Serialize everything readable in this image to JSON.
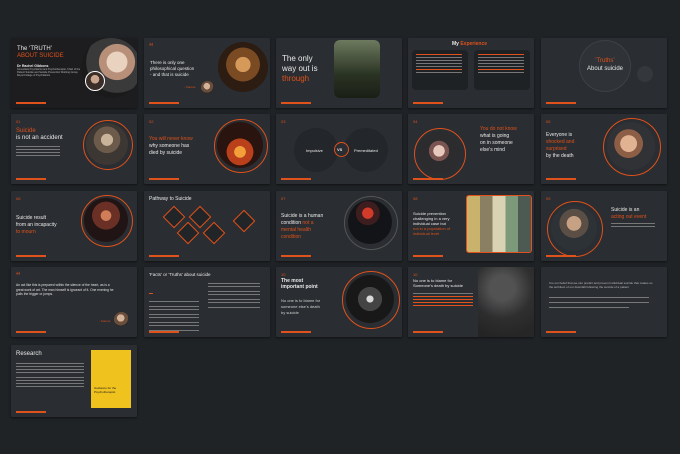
{
  "slides": [
    {
      "title_l1": "The ‘TRUTH’",
      "title_l2": "ABOUT SUICIDE",
      "author": "Dr Rachel Gibbons",
      "author_desc": "Consultant Psychiatrist and Psychotherapist, Chair of the Patient Suicide and Suicide Prevention Working Group, Royal College of Psychiatrists"
    },
    {
      "quote_l1": "There is only one",
      "quote_l2": "philosophical question",
      "quote_l3": "- and that is suicide",
      "attribution": "- Camus"
    },
    {
      "l1": "The only",
      "l2": "way out is",
      "l3": "through"
    },
    {
      "prefix": "My",
      "title": "Experience"
    },
    {
      "l1": "‘Truths’",
      "l2": "About suicide"
    },
    {
      "num": "01",
      "l1": "Suicide",
      "l2": "is not an accident"
    },
    {
      "num": "02",
      "l1": "You will never know",
      "l2": "why someone has",
      "l3": "died by suicide"
    },
    {
      "num": "03",
      "left": "Impulsive",
      "vs": "VS",
      "right": "Premeditated"
    },
    {
      "num": "04",
      "l1": "You do not know",
      "l2": "what is going",
      "l3": "on in someone",
      "l4": "else’s mind"
    },
    {
      "num": "05",
      "l1": "Everyone is",
      "l2": "shocked and",
      "l3": "surprised",
      "l4": "by the death"
    },
    {
      "num": "06",
      "l1": "Suicide result",
      "l2": "from an incapacity",
      "l3": "to mourn"
    },
    {
      "title": "Pathway to Suicide"
    },
    {
      "num": "07",
      "l1": "Suicide is a human",
      "l2": "condition",
      "l2b": "not a",
      "l3": "mental health",
      "l4": "condition"
    },
    {
      "num": "08",
      "l1": "Suicide prevention",
      "l2": "challenging in a very",
      "l3": "individual case but",
      "l4": "not in a population of",
      "l5": "individual level"
    },
    {
      "num": "09",
      "l1": "Suicide is an",
      "l2": "acting out event"
    },
    {
      "quote": "An act like this is prepared within the silence of the heart, as is a great work of art. The man himself is ignorant of it. One evening he pulls the trigger or jumps.",
      "attribution": "- Camus"
    },
    {
      "title": "‘Facts’ or ‘Truths’ about suicide"
    },
    {
      "num": "10",
      "l1": "The most",
      "l2": "important point",
      "l3": "No one is to blame for",
      "l4": "someone else’s death",
      "l5": "by suicide"
    },
    {
      "num": "10",
      "l1": "No one is to blame for",
      "l2": "Someone’s death by suicide"
    },
    {
      "l1": "It is our belief that we can predict and prevent individual suicide that makes us the architect of our downfall following the suicide of a patient"
    },
    {
      "title": "Research",
      "book_l1": "Guidance for the",
      "book_l2": "Psychotherapist"
    }
  ]
}
